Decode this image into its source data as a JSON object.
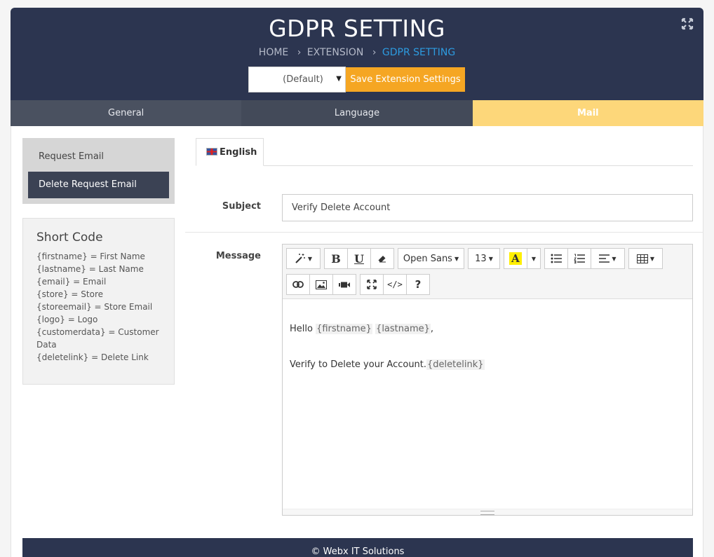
{
  "header": {
    "title": "GDPR SETTING",
    "breadcrumb": [
      "HOME",
      "EXTENSION",
      "GDPR SETTING"
    ],
    "breadcrumb_sep": "›",
    "store_select": "(Default)",
    "save_label": "Save Extension Settings"
  },
  "tabs": [
    "General",
    "Language",
    "Mail"
  ],
  "active_tab": "Mail",
  "side_menu": [
    "Request Email",
    "Delete Request Email"
  ],
  "active_side_item": "Delete Request Email",
  "short_code": {
    "title": "Short Code",
    "lines": [
      "{firstname} = First Name",
      "{lastname} = Last Name",
      "{email} = Email",
      "{store} = Store",
      "{storeemail} = Store Email",
      "{logo} = Logo",
      "{customerdata} = Customer",
      "Data",
      "{deletelink} = Delete Link"
    ]
  },
  "language_tab": "English",
  "form": {
    "subject_label": "Subject",
    "subject_value": "Verify Delete Account",
    "message_label": "Message"
  },
  "editor": {
    "font_name": "Open Sans",
    "font_size": "13",
    "color_glyph": "A",
    "bold_glyph": "B",
    "underline_glyph": "U",
    "help_glyph": "?",
    "code_glyph": "</>",
    "line1_prefix": "Hello ",
    "line1_token1": "{firstname}",
    "line1_space": " ",
    "line1_token2": "{lastname}",
    "line1_suffix": ",",
    "line2_prefix": "Verify to Delete your Account.",
    "line2_token": "{deletelink}"
  },
  "footer": "© Webx IT Solutions",
  "colors": {
    "header_bg": "#2c3550",
    "accent_orange": "#f5a623",
    "active_tab": "#fdd77a",
    "breadcrumb_active": "#2d9be0"
  }
}
